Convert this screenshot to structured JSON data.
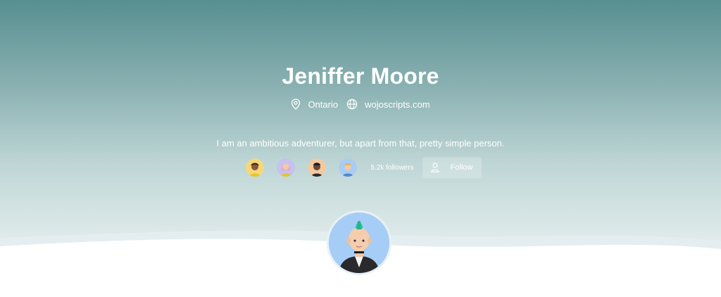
{
  "profile": {
    "name": "Jeniffer Moore",
    "location": "Ontario",
    "website": "wojoscripts.com",
    "bio": "I am an ambitious adventurer, but apart from that, pretty simple person."
  },
  "social": {
    "followers_label": "5.2k followers",
    "follow_label": "Follow",
    "avatars": [
      "avatar-1",
      "avatar-2",
      "avatar-3",
      "avatar-4"
    ]
  },
  "icons": {
    "location": "map-pin-icon",
    "website": "globe-icon",
    "follow": "user-icon"
  },
  "colors": {
    "header_top": "#578f90",
    "header_bottom": "#e6eeee",
    "avatar_bg": "#a6cdf5",
    "mohawk": "#27c39b"
  }
}
